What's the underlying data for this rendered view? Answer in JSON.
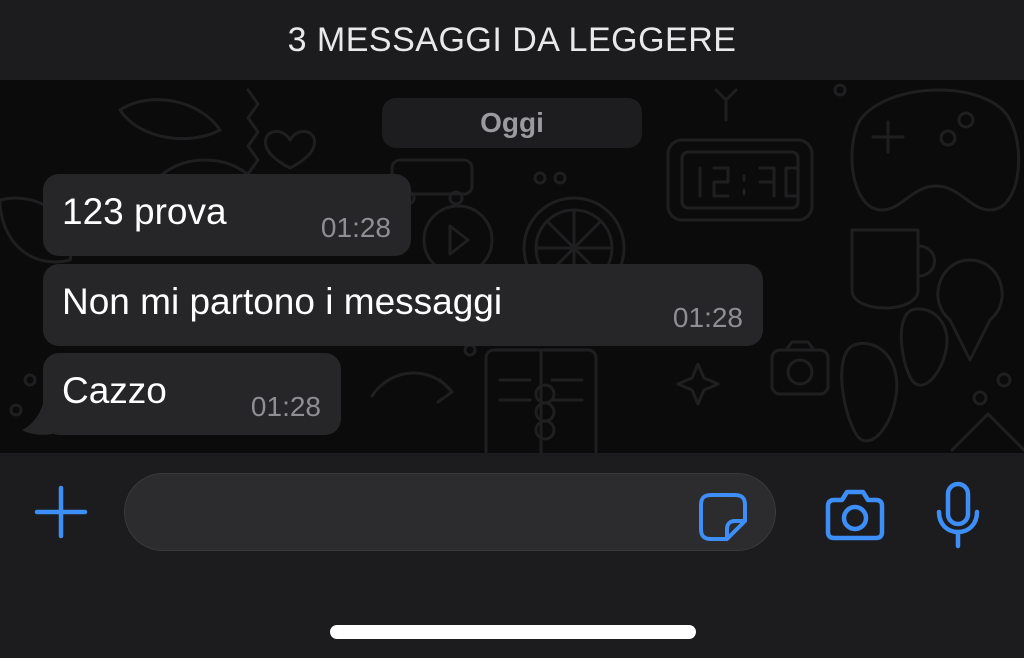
{
  "banner": {
    "unread_label": "3 MESSAGGI DA LEGGERE"
  },
  "chat": {
    "date_label": "Oggi",
    "messages": [
      {
        "text": "123 prova",
        "time": "01:28"
      },
      {
        "text": "Non mi partono i messaggi",
        "time": "01:28"
      },
      {
        "text": "Cazzo",
        "time": "01:28"
      }
    ]
  },
  "composer": {
    "placeholder": ""
  },
  "icons": {
    "attach": "plus-icon",
    "sticker": "sticker-icon",
    "camera": "camera-icon",
    "mic": "microphone-icon"
  },
  "colors": {
    "accent": "#3e8ef7",
    "bubble": "#262628",
    "bar": "#1c1c1e",
    "time_text": "#8e8e93"
  }
}
